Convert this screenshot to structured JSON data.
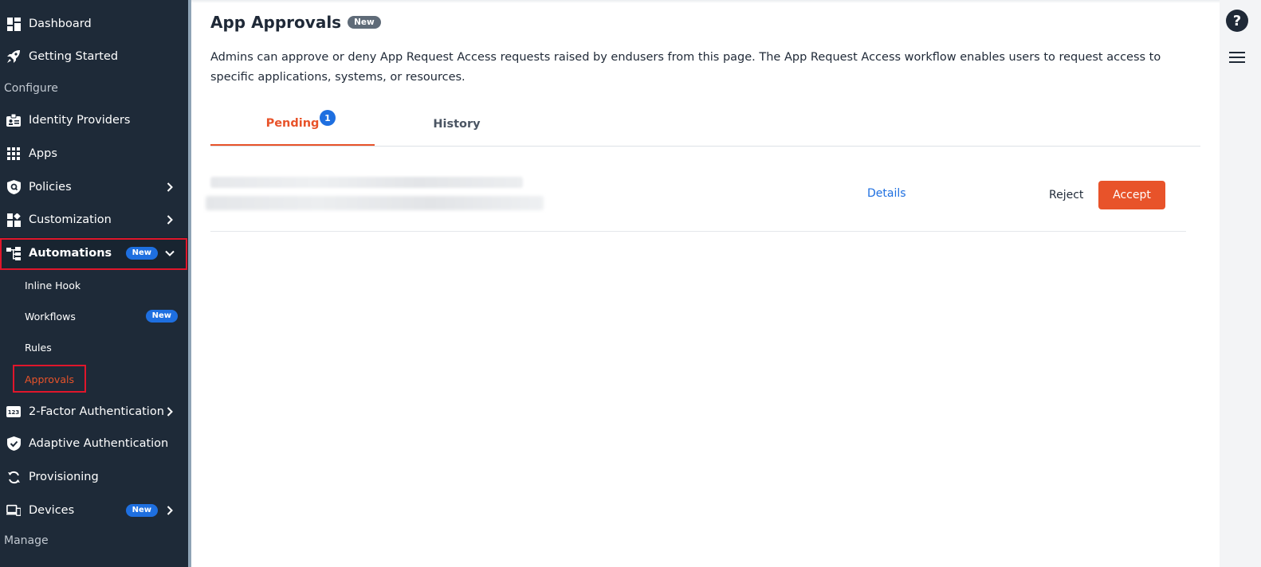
{
  "sidebar": {
    "items": [
      {
        "label": "Dashboard",
        "icon": "dashboard-icon"
      },
      {
        "label": "Getting Started",
        "icon": "rocket-icon"
      },
      {
        "label": "Identity Providers",
        "icon": "id-badge-icon"
      },
      {
        "label": "Apps",
        "icon": "grid-icon"
      },
      {
        "label": "Policies",
        "icon": "shield-icon"
      },
      {
        "label": "Customization",
        "icon": "customize-icon"
      },
      {
        "label": "Automations",
        "icon": "automation-icon",
        "badge": "New",
        "expanded": true
      },
      {
        "label": "2-Factor Authentication",
        "icon": "two-factor-icon"
      },
      {
        "label": "Adaptive Authentication",
        "icon": "shield-check-icon"
      },
      {
        "label": "Provisioning",
        "icon": "sync-icon"
      },
      {
        "label": "Devices",
        "icon": "devices-icon",
        "badge": "New"
      }
    ],
    "sections": {
      "configure": "Configure",
      "manage": "Manage"
    },
    "automations_sub": [
      {
        "label": "Inline Hook"
      },
      {
        "label": "Workflows",
        "badge": "New"
      },
      {
        "label": "Rules"
      },
      {
        "label": "Approvals",
        "active": true
      }
    ]
  },
  "main": {
    "title": "App Approvals",
    "title_badge": "New",
    "description": "Admins can approve or deny App Request Access requests raised by endusers from this page. The App Request Access workflow enables users to request access to specific applications, systems, or resources.",
    "tabs": [
      {
        "label": "Pending",
        "count": "1",
        "active": true
      },
      {
        "label": "History",
        "active": false
      }
    ],
    "request_row": {
      "details_label": "Details",
      "reject_label": "Reject",
      "accept_label": "Accept"
    }
  },
  "colors": {
    "sidebar_bg": "#1e2a38",
    "accent_orange": "#e8532a",
    "link_blue": "#1e6fe0",
    "highlight_red": "#e0162b"
  }
}
